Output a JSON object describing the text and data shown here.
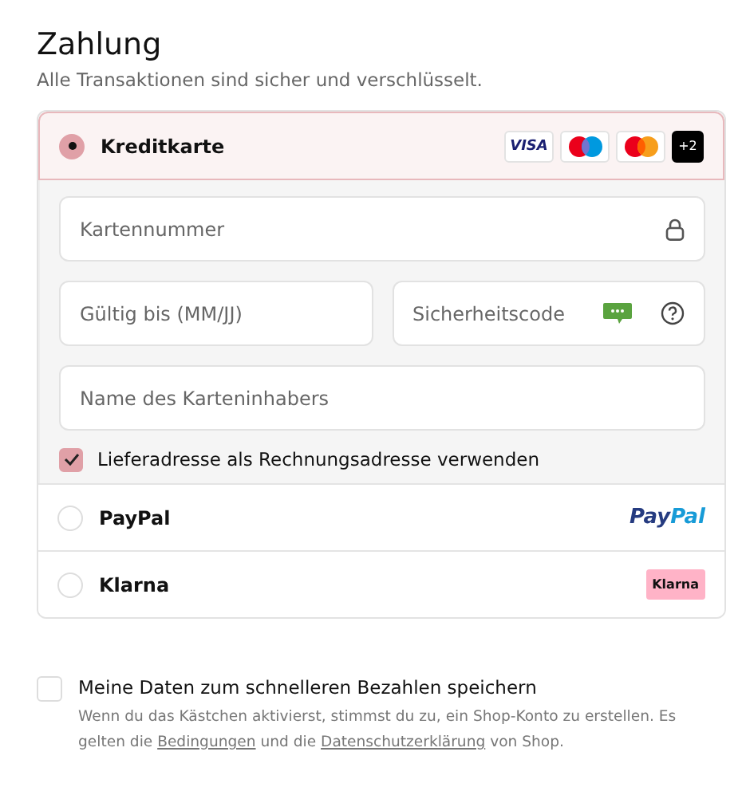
{
  "title": "Zahlung",
  "subtitle": "Alle Transaktionen sind sicher und verschlüsselt.",
  "methods": [
    {
      "kind": "card",
      "label": "Kreditkarte",
      "selected": true,
      "badges": [
        {
          "kind": "visa",
          "text": "VISA"
        },
        {
          "kind": "maestro"
        },
        {
          "kind": "mastercard"
        },
        {
          "kind": "more",
          "text": "+2"
        }
      ]
    },
    {
      "kind": "paypal",
      "label": "PayPal",
      "selected": false,
      "logo": [
        "Pay",
        "Pal"
      ]
    },
    {
      "kind": "klarna",
      "label": "Klarna",
      "selected": false,
      "logo": [
        "Klarna"
      ]
    }
  ],
  "card_form": {
    "number": {
      "placeholder": "Kartennummer"
    },
    "expiry": {
      "placeholder": "Gültig bis (MM/JJ)"
    },
    "cvc": {
      "placeholder": "Sicherheitscode"
    },
    "name": {
      "placeholder": "Name des Karteninhabers"
    },
    "billing_same": {
      "label": "Lieferadresse als Rechnungsadresse verwenden",
      "checked": true
    }
  },
  "save": {
    "label": "Meine Daten zum schnelleren Bezahlen speichern",
    "checked": false,
    "note": [
      {
        "kind": "text",
        "text": "Wenn du das Kästchen aktivierst, stimmst du zu, ein Shop-Konto zu erstellen. Es gelten die "
      },
      {
        "kind": "link",
        "text": "Bedingungen"
      },
      {
        "kind": "text",
        "text": " und die "
      },
      {
        "kind": "link",
        "text": "Datenschutzerklärung"
      },
      {
        "kind": "text",
        "text": " von Shop."
      }
    ]
  }
}
